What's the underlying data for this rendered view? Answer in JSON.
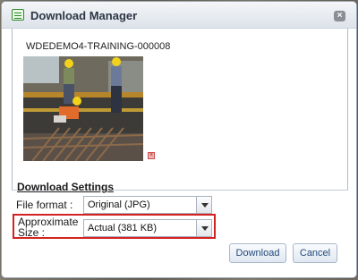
{
  "dialog": {
    "title": "Download Manager",
    "icon": "download-manager-icon",
    "close_icon": "close-icon"
  },
  "asset": {
    "name": "WDEDEMO4-TRAINING-000008",
    "thumbnail_subject": "construction workers on rebar cage",
    "remove_icon": "remove-icon"
  },
  "settings": {
    "heading": "Download Settings",
    "file_format_label": "File format :",
    "file_format_value": "Original (JPG)",
    "size_label_line1": "Approximate",
    "size_label_line2": "Size :",
    "size_value": "Actual (381 KB)"
  },
  "buttons": {
    "download": "Download",
    "cancel": "Cancel"
  },
  "colors": {
    "highlight": "#d42222",
    "button_text": "#234a7a"
  }
}
